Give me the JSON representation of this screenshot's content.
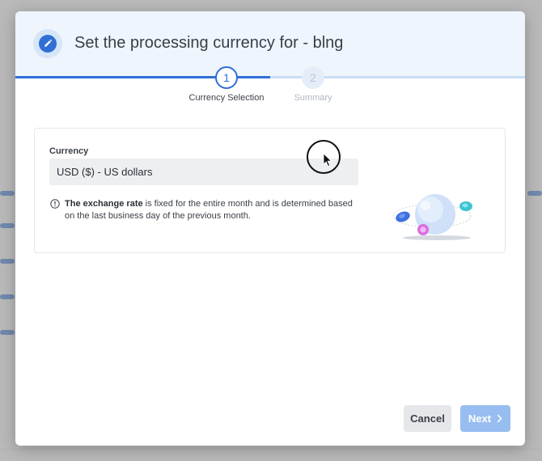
{
  "modal": {
    "title": "Set the processing currency for - blng",
    "header_icon": "pencil-icon"
  },
  "stepper": {
    "steps": [
      {
        "number": "1",
        "label": "Currency Selection",
        "state": "active"
      },
      {
        "number": "2",
        "label": "Summary",
        "state": "inactive"
      }
    ],
    "progress_fraction": 0.5
  },
  "form": {
    "currency_label": "Currency",
    "currency_value": "USD ($) - US dollars",
    "info": {
      "bold": "The exchange rate",
      "rest": " is fixed for the entire month and is determined based on the last business day of the previous month."
    }
  },
  "footer": {
    "cancel_label": "Cancel",
    "next_label": "Next"
  },
  "colors": {
    "primary": "#2f6fd6",
    "next_disabled": "#98bdf0",
    "header_bg": "#eef5fc"
  }
}
